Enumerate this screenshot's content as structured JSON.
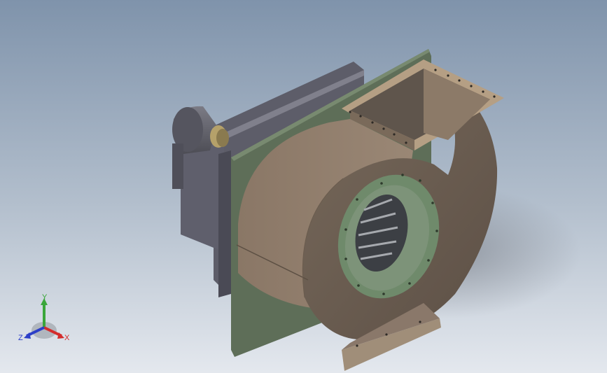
{
  "viewport": {
    "background_top": "#7f93ab",
    "background_bottom": "#e4e8ee"
  },
  "model": {
    "casing_color": "#8d7a68",
    "casing_shadow": "#5e5044",
    "plate_color": "#5e6e58",
    "motor_color": "#6f6f79",
    "inlet_ring_color": "#7d9379"
  },
  "triad": {
    "x_label": "X",
    "y_label": "Y",
    "z_label": "Z",
    "x_color": "#d42c2c",
    "y_color": "#3aa63a",
    "z_color": "#2c3fc8"
  }
}
